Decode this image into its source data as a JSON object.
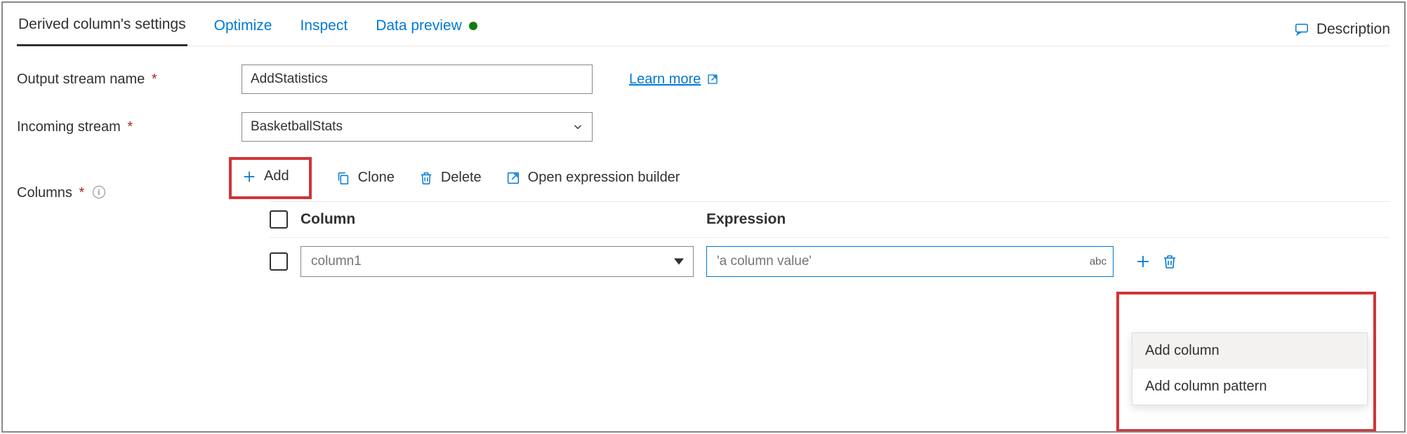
{
  "tabs": {
    "settings": "Derived column's settings",
    "optimize": "Optimize",
    "inspect": "Inspect",
    "preview": "Data preview"
  },
  "description_label": "Description",
  "labels": {
    "output_stream": "Output stream name",
    "incoming_stream": "Incoming stream",
    "columns": "Columns"
  },
  "output_stream_value": "AddStatistics",
  "incoming_stream_value": "BasketballStats",
  "learn_more": "Learn more",
  "toolbar": {
    "add": "Add",
    "clone": "Clone",
    "delete": "Delete",
    "open_builder": "Open expression builder"
  },
  "columns_table": {
    "head_column": "Column",
    "head_expression": "Expression",
    "rows": [
      {
        "name_placeholder": "column1",
        "expr_placeholder": "'a column value'",
        "expr_badge": "abc"
      }
    ]
  },
  "dropdown": {
    "add_column": "Add column",
    "add_pattern": "Add column pattern"
  }
}
